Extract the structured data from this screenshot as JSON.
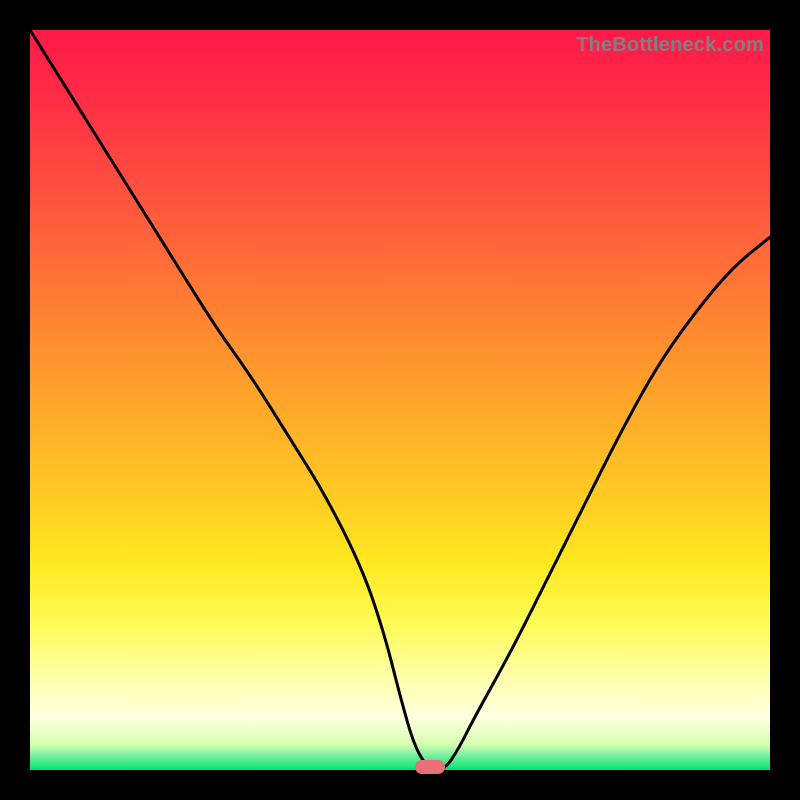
{
  "watermark": "TheBottleneck.com",
  "colors": {
    "frame": "#000000",
    "curve_stroke": "#000000",
    "marker_fill": "#e96f79",
    "watermark_text": "#808080",
    "gradient_top": "#ff1848",
    "gradient_mid": "#ffe81f",
    "gradient_bottom": "#00e472"
  },
  "chart_data": {
    "type": "line",
    "title": "",
    "xlabel": "",
    "ylabel": "",
    "xlim": [
      0,
      100
    ],
    "ylim": [
      0,
      100
    ],
    "grid": false,
    "legend": false,
    "annotations": [
      {
        "type": "pill-marker",
        "x": 54,
        "y": 0
      }
    ],
    "series": [
      {
        "name": "bottleneck-curve",
        "x": [
          0,
          5,
          10,
          15,
          20,
          25,
          30,
          35,
          40,
          45,
          48,
          50,
          52,
          54,
          56,
          58,
          60,
          65,
          70,
          75,
          80,
          85,
          90,
          95,
          100
        ],
        "y": [
          100,
          92,
          84,
          76,
          68,
          60,
          53,
          45,
          37,
          27,
          18,
          10,
          3,
          0,
          0,
          3,
          7,
          16,
          26,
          36,
          46,
          55,
          62,
          68,
          72
        ]
      }
    ],
    "note": "x is horizontal position (0=left, 100=right); y is curve height (0=bottom green band, 100=top edge). Values estimated from pixels."
  }
}
